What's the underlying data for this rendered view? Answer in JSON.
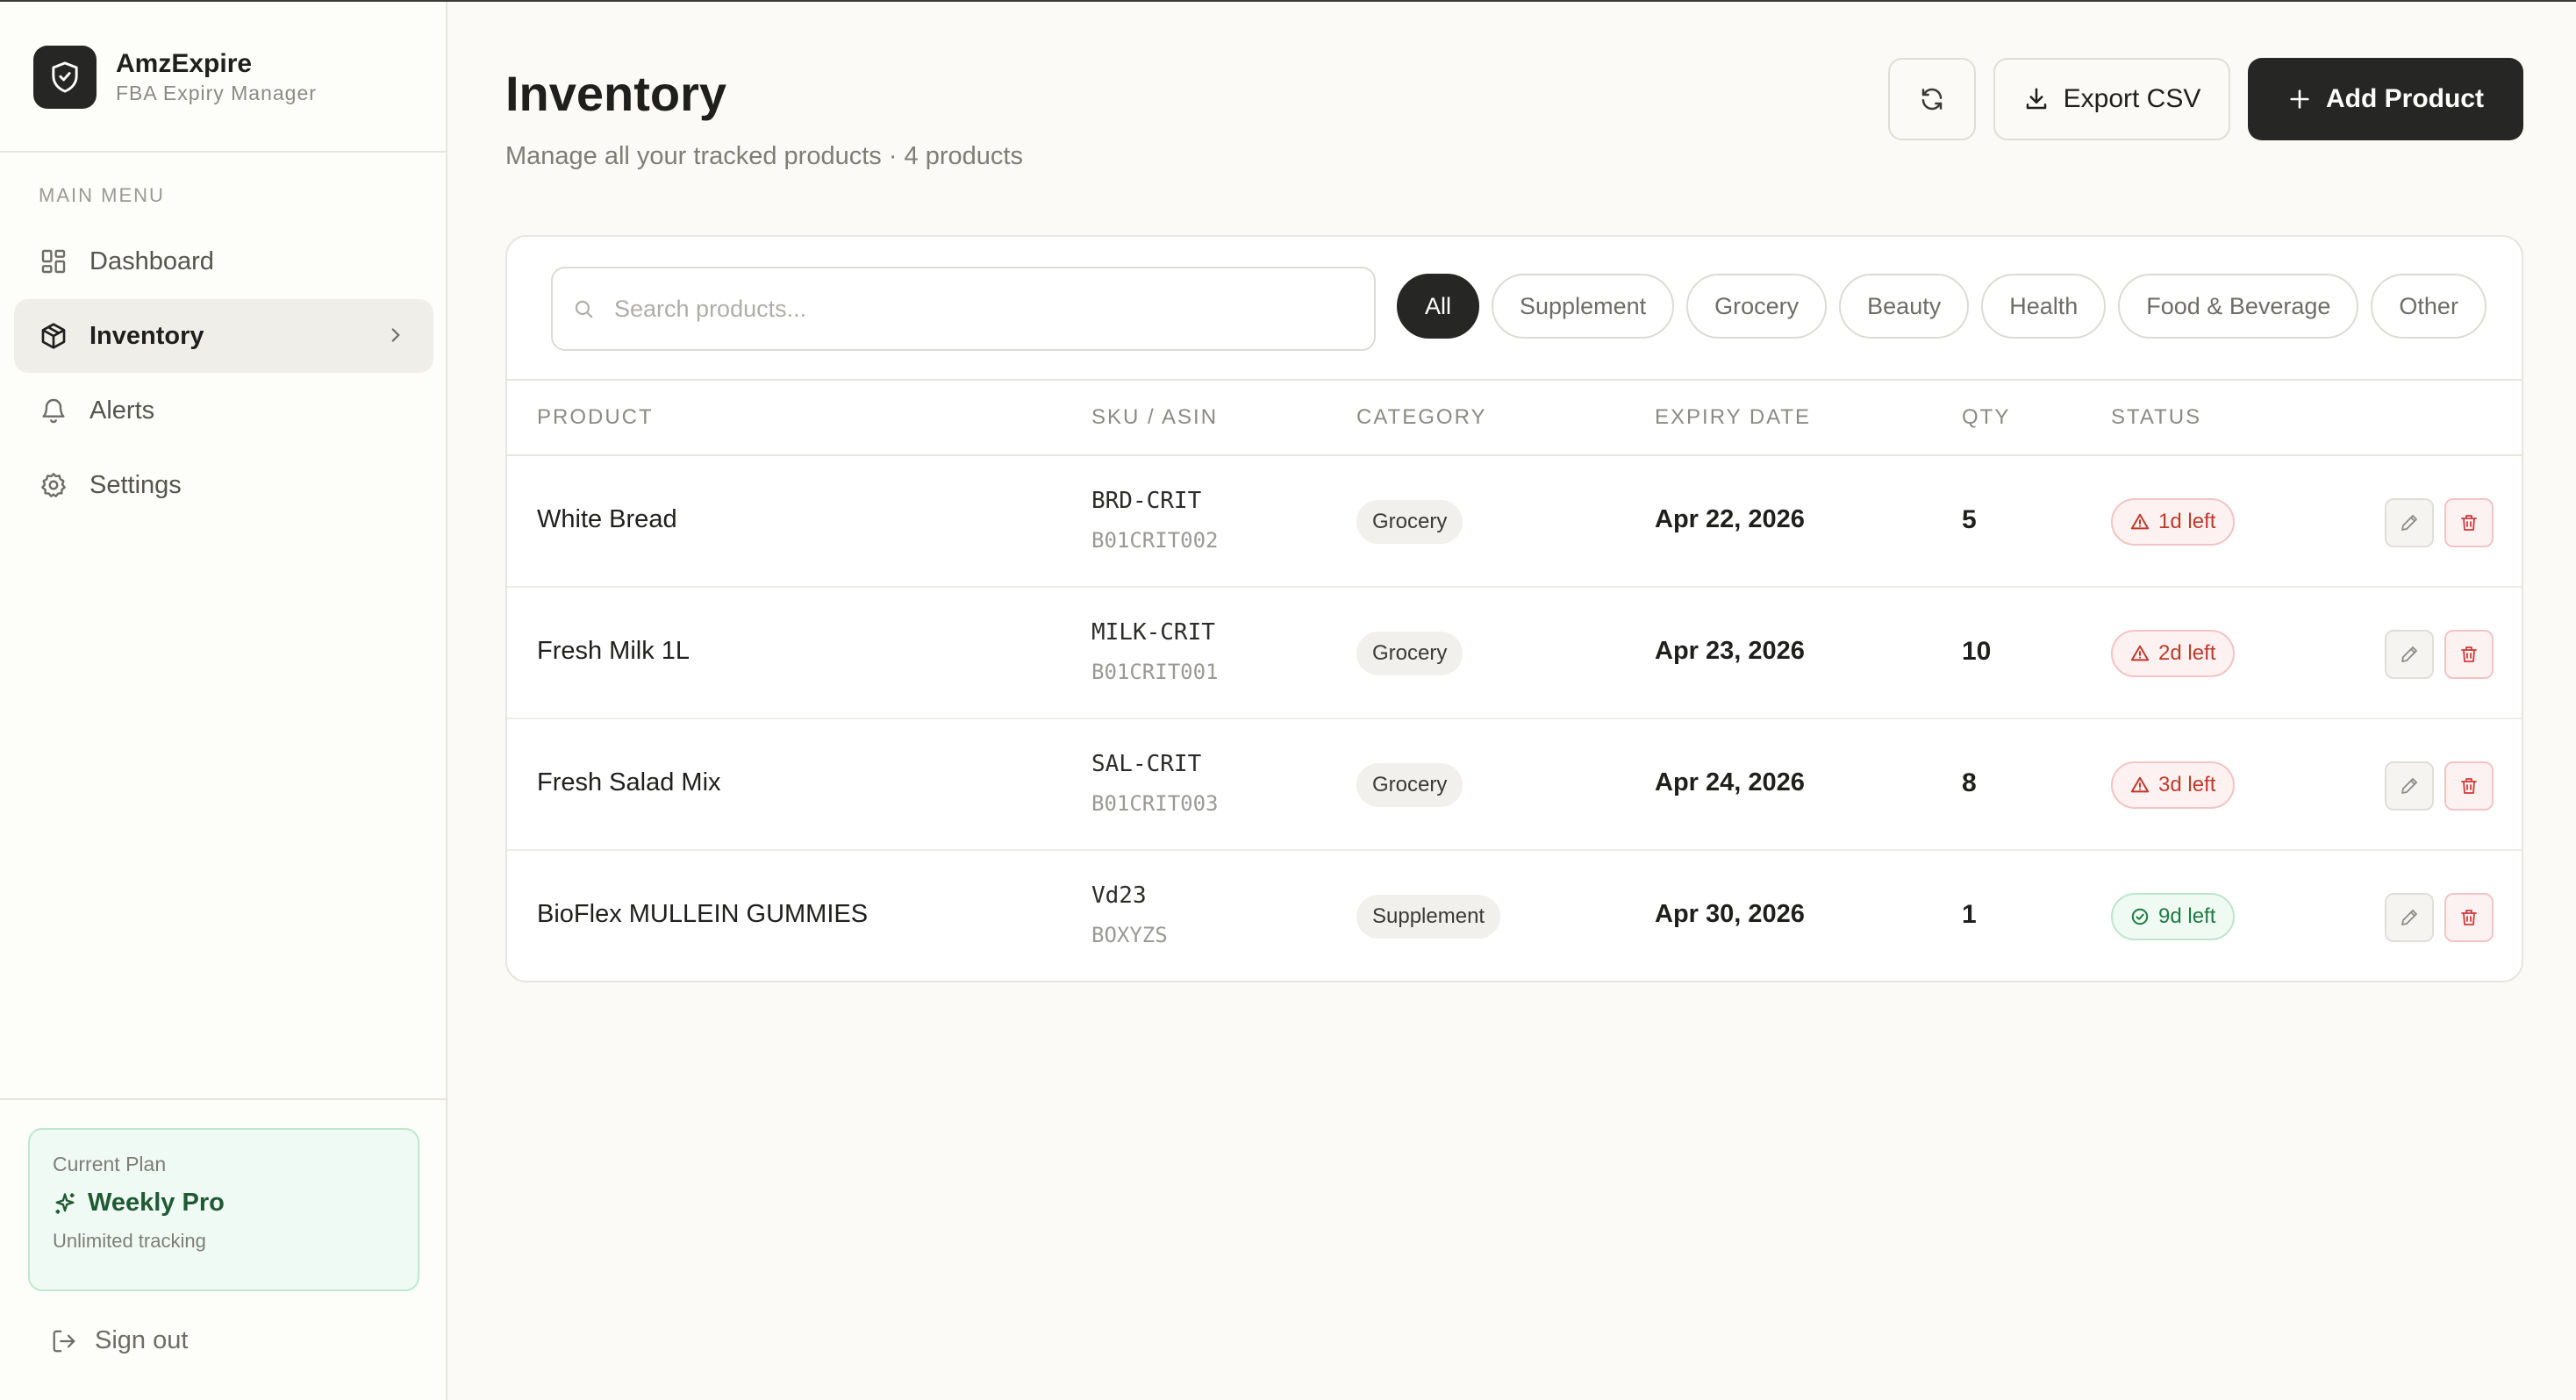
{
  "app": {
    "name": "AmzExpire",
    "subtitle": "FBA Expiry Manager"
  },
  "sidebar": {
    "menu_heading": "MAIN MENU",
    "items": [
      {
        "label": "Dashboard",
        "icon": "dashboard-icon"
      },
      {
        "label": "Inventory",
        "icon": "package-icon",
        "active": true
      },
      {
        "label": "Alerts",
        "icon": "bell-icon"
      },
      {
        "label": "Settings",
        "icon": "gear-icon"
      }
    ],
    "plan": {
      "label": "Current Plan",
      "name": "Weekly Pro",
      "description": "Unlimited tracking"
    },
    "signout_label": "Sign out"
  },
  "header": {
    "title": "Inventory",
    "subtitle": "Manage all your tracked products · 4 products",
    "export_label": "Export CSV",
    "add_label": "Add Product"
  },
  "search": {
    "placeholder": "Search products...",
    "value": ""
  },
  "filters": [
    "All",
    "Supplement",
    "Grocery",
    "Beauty",
    "Health",
    "Food & Beverage",
    "Other"
  ],
  "active_filter": "All",
  "table": {
    "columns": [
      "PRODUCT",
      "SKU / ASIN",
      "CATEGORY",
      "EXPIRY DATE",
      "QTY",
      "STATUS"
    ],
    "rows": [
      {
        "product": "White Bread",
        "sku": "BRD-CRIT",
        "asin": "B01CRIT002",
        "category": "Grocery",
        "expiry": "Apr 22, 2026",
        "qty": "5",
        "status": "1d left",
        "status_type": "critical"
      },
      {
        "product": "Fresh Milk 1L",
        "sku": "MILK-CRIT",
        "asin": "B01CRIT001",
        "category": "Grocery",
        "expiry": "Apr 23, 2026",
        "qty": "10",
        "status": "2d left",
        "status_type": "critical"
      },
      {
        "product": "Fresh Salad Mix",
        "sku": "SAL-CRIT",
        "asin": "B01CRIT003",
        "category": "Grocery",
        "expiry": "Apr 24, 2026",
        "qty": "8",
        "status": "3d left",
        "status_type": "critical"
      },
      {
        "product": "BioFlex MULLEIN GUMMIES",
        "sku": "Vd23",
        "asin": "BOXYZS",
        "category": "Supplement",
        "expiry": "Apr 30, 2026",
        "qty": "1",
        "status": "9d left",
        "status_type": "ok"
      }
    ]
  },
  "colors": {
    "accent_dark": "#262624",
    "critical": "#c0392b",
    "ok": "#1f7a44",
    "plan_green": "#1f5a34"
  }
}
